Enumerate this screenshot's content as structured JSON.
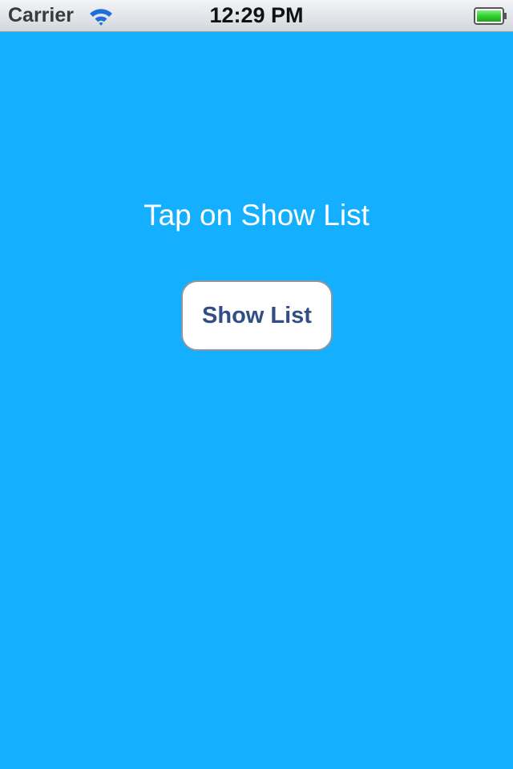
{
  "status_bar": {
    "carrier": "Carrier",
    "time": "12:29 PM",
    "wifi_icon": "wifi-icon",
    "battery_icon": "battery-full-icon",
    "battery_level": 1.0,
    "battery_color": "#2fd12f"
  },
  "main": {
    "instruction": "Tap on Show List",
    "button_label": "Show List",
    "background_color": "#14b0ff",
    "button_text_color": "#324f85"
  }
}
